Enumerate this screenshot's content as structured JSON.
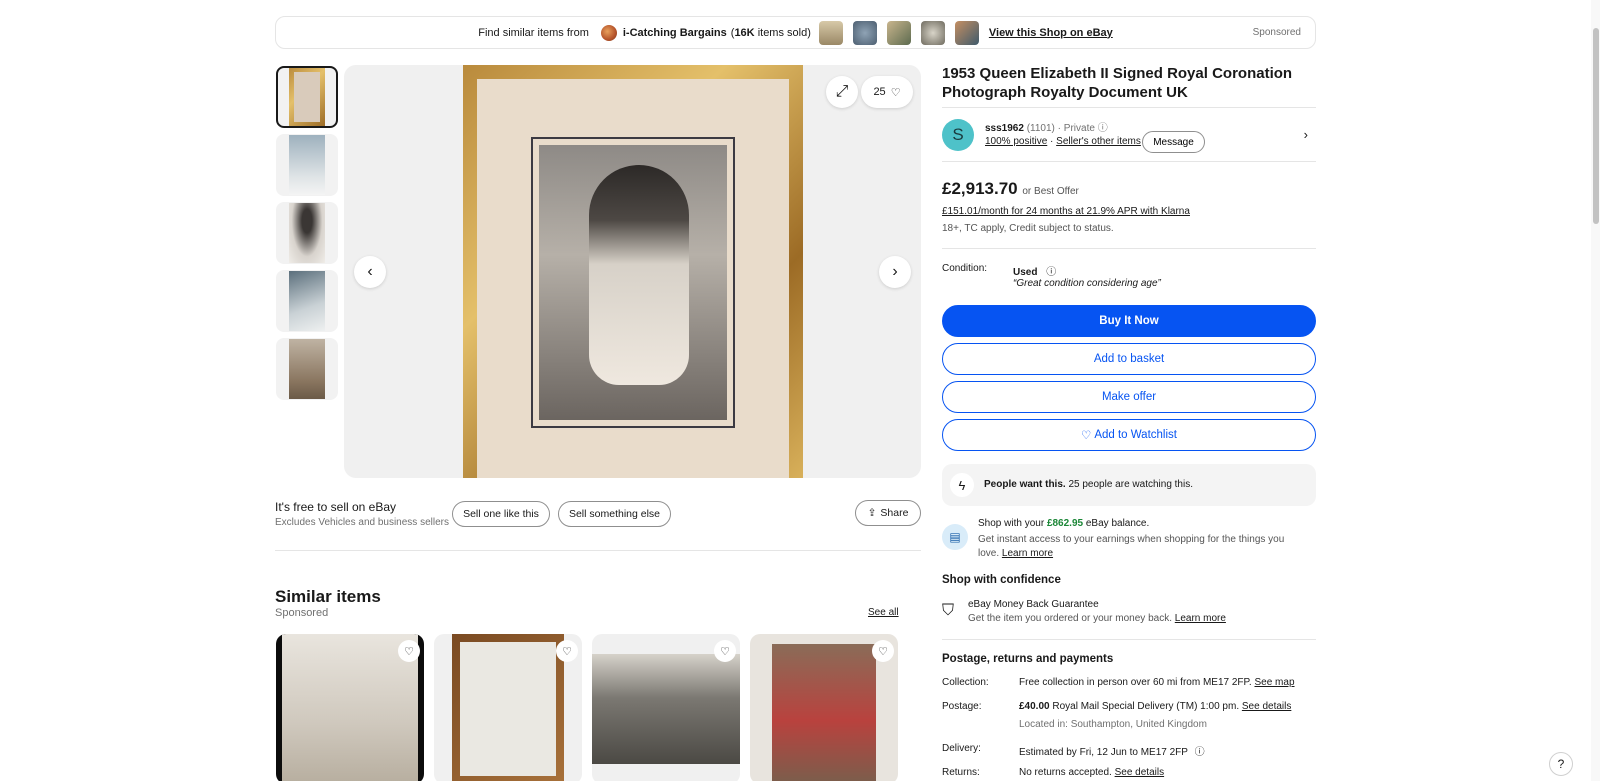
{
  "promo": {
    "find_label": "Find similar items from",
    "shop_name": "i-Catching Bargains",
    "shop_count_bold": "16K",
    "shop_count_rest": "items sold)",
    "shop_count_open": "(",
    "view_shop": "View this Shop on eBay",
    "sponsored": "Sponsored"
  },
  "gallery": {
    "watch_count": "25"
  },
  "sell": {
    "title": "It's free to sell on eBay",
    "subtitle": "Excludes Vehicles and business sellers",
    "sell_one": "Sell one like this",
    "sell_other": "Sell something else",
    "share": "Share"
  },
  "similar": {
    "title": "Similar items",
    "sponsored": "Sponsored",
    "see_all": "See all"
  },
  "item": {
    "title": "1953 Queen Elizabeth II Signed Royal Coronation Photograph Royalty Document UK"
  },
  "seller": {
    "initial": "S",
    "name": "sss1962",
    "feedback": "(1101)",
    "type": "· Private",
    "positive": "100% positive",
    "other_items": "Seller's other items",
    "message": "Message"
  },
  "pricing": {
    "price": "£2,913.70",
    "best_offer": "or Best Offer",
    "klarna": "£151.01/month for 24 months at 21.9% APR with Klarna",
    "tc": "18+, TC apply, Credit subject to status."
  },
  "condition": {
    "label": "Condition:",
    "value": "Used",
    "quote": "“Great condition considering age”"
  },
  "buttons": {
    "buy": "Buy It Now",
    "basket": "Add to basket",
    "offer": "Make offer",
    "watch": "Add to Watchlist"
  },
  "people": {
    "bold": "People want this.",
    "rest": "25 people are watching this."
  },
  "balance": {
    "pre": "Shop with your",
    "amount": "£862.95",
    "post": "eBay balance.",
    "desc": "Get instant access to your earnings when shopping for the things you love.",
    "learn": "Learn more"
  },
  "confidence": {
    "title": "Shop with confidence",
    "line1": "eBay Money Back Guarantee",
    "line2": "Get the item you ordered or your money back.",
    "learn": "Learn more"
  },
  "postage": {
    "title": "Postage, returns and payments",
    "collection_label": "Collection:",
    "collection_value": "Free collection in person over 60 mi from ME17 2FP.",
    "collection_link": "See map",
    "postage_label": "Postage:",
    "postage_price": "£40.00",
    "postage_value": "Royal Mail Special Delivery (TM) 1:00 pm.",
    "postage_link": "See details",
    "located": "Located in: Southampton, United Kingdom",
    "delivery_label": "Delivery:",
    "delivery_value": "Estimated by Fri, 12 Jun to ME17 2FP",
    "returns_label": "Returns:",
    "returns_value": "No returns accepted.",
    "returns_link": "See details"
  },
  "help": "?",
  "colors": {
    "primary": "#0654f2",
    "avatar": "#4ec2c9",
    "balance_green": "#1a8636"
  }
}
